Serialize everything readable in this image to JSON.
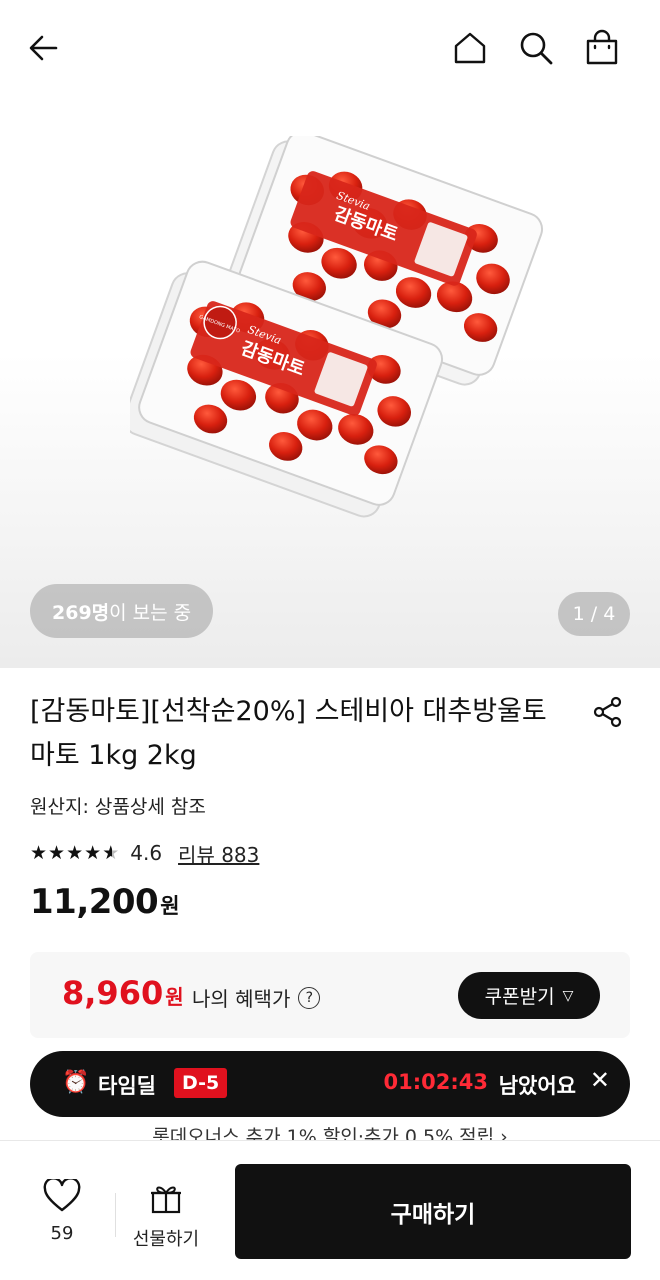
{
  "header": {
    "back_icon": "arrow-left-icon",
    "home_icon": "home-icon",
    "search_icon": "search-icon",
    "bag_icon": "shopping-bag-icon"
  },
  "gallery": {
    "viewers_count": "269명",
    "viewers_suffix": "이 보는 중",
    "counter": "1 / 4",
    "image_label_line1": "Stevia",
    "image_label_line2": "감동마토",
    "brand_badge": "GAMDONG MATO"
  },
  "product": {
    "title": "[감동마토][선착순20%] 스테비아 대추방울토마토 1kg 2kg",
    "origin": "원산지: 상품상세 참조",
    "rating": "4.6",
    "stars": 4.6,
    "review_link": "리뷰 883",
    "price": "11,200",
    "price_unit": "원"
  },
  "benefit": {
    "price": "8,960",
    "price_unit": "원",
    "label": "나의 혜택가",
    "help_symbol": "?",
    "coupon_button": "쿠폰받기",
    "accent_color": "#e0111e"
  },
  "timedeal": {
    "clock_icon": "⏰",
    "label": "타임딜",
    "dday": "D-5",
    "timer": "01:02:43",
    "remain": "남았어요",
    "close_symbol": "✕"
  },
  "loyalty_text": "롯데오너스 추가 1% 할인·추가 0.5% 적립 ›",
  "bottom_bar": {
    "like_count": "59",
    "gift_label": "선물하기",
    "buy_label": "구매하기"
  }
}
